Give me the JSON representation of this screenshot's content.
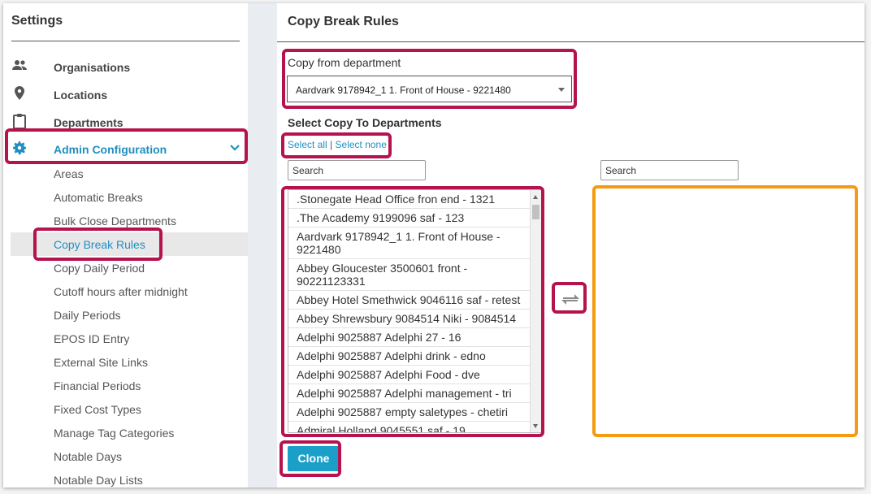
{
  "sidebar": {
    "title": "Settings",
    "nav": [
      {
        "label": "Organisations",
        "icon": "people-icon"
      },
      {
        "label": "Locations",
        "icon": "map-pin-icon"
      },
      {
        "label": "Departments",
        "icon": "clipboard-icon"
      },
      {
        "label": "Admin Configuration",
        "icon": "gear-icon",
        "active": true
      }
    ],
    "sub_items": [
      "Areas",
      "Automatic Breaks",
      "Bulk Close Departments",
      "Copy Break Rules",
      "Copy Daily Period",
      "Cutoff hours after midnight",
      "Daily Periods",
      "EPOS ID Entry",
      "External Site Links",
      "Financial Periods",
      "Fixed Cost Types",
      "Manage Tag Categories",
      "Notable Days",
      "Notable Day Lists"
    ],
    "selected_sub_item": "Copy Break Rules"
  },
  "main": {
    "title": "Copy Break Rules",
    "copy_from_label": "Copy from department",
    "copy_from_value": "Aardvark 9178942_1 1. Front of House - 9221480",
    "copy_to_label": "Select Copy To Departments",
    "select_all": "Select all",
    "separator": "|",
    "select_none": "Select none",
    "search_left_placeholder": "Search",
    "search_right_placeholder": "Search",
    "departments": [
      ".Stonegate Head Office fron end - 1321",
      ".The Academy 9199096 saf - 123",
      "Aardvark 9178942_1 1. Front of House - 9221480",
      "Abbey Gloucester 3500601 front - 90221123331",
      "Abbey Hotel Smethwick 9046116 saf - retest",
      "Abbey Shrewsbury 9084514 Niki - 9084514",
      "Adelphi 9025887 Adelphi 27 - 16",
      "Adelphi 9025887 Adelphi drink - edno",
      "Adelphi 9025887 Adelphi Food - dve",
      "Adelphi 9025887 Adelphi management - tri",
      "Adelphi 9025887 empty saletypes - chetiri",
      "Admiral Holland 9045551 saf - 19"
    ],
    "clone_label": "Clone"
  },
  "colors": {
    "accent": "#1f8fc1",
    "button": "#1aa0c8",
    "highlight": "#b5134e",
    "target_highlight": "#f59b12"
  }
}
